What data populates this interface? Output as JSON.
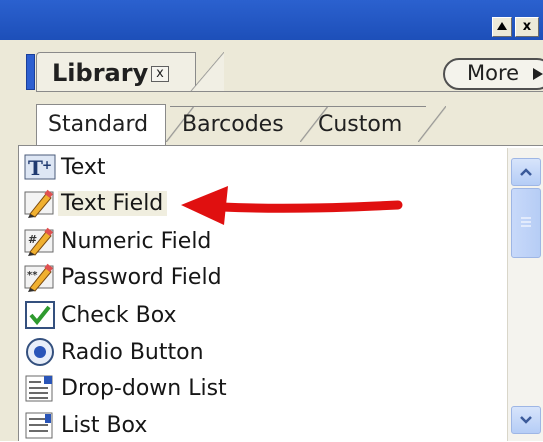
{
  "window": {
    "minimize_icon": "up-triangle-icon",
    "close_label": "x"
  },
  "panel": {
    "title": "Library",
    "close_label": "x",
    "more_label": "More",
    "more_icon": "right-triangle-icon"
  },
  "tabs": [
    {
      "label": "Standard",
      "active": true
    },
    {
      "label": "Barcodes",
      "active": false
    },
    {
      "label": "Custom",
      "active": false
    }
  ],
  "items": [
    {
      "label": "Text",
      "icon": "text-tool-icon"
    },
    {
      "label": "Text Field",
      "icon": "pencil-field-icon",
      "selected": true
    },
    {
      "label": "Numeric Field",
      "icon": "numeric-field-icon"
    },
    {
      "label": "Password Field",
      "icon": "password-field-icon"
    },
    {
      "label": "Check Box",
      "icon": "checkbox-icon"
    },
    {
      "label": "Radio Button",
      "icon": "radio-button-icon"
    },
    {
      "label": "Drop-down List",
      "icon": "dropdown-list-icon"
    },
    {
      "label": "List Box",
      "icon": "list-box-icon"
    }
  ],
  "colors": {
    "title_bar": "#2b61cf",
    "annotation_arrow": "#e01010",
    "panel_bg": "#ece9d8"
  }
}
